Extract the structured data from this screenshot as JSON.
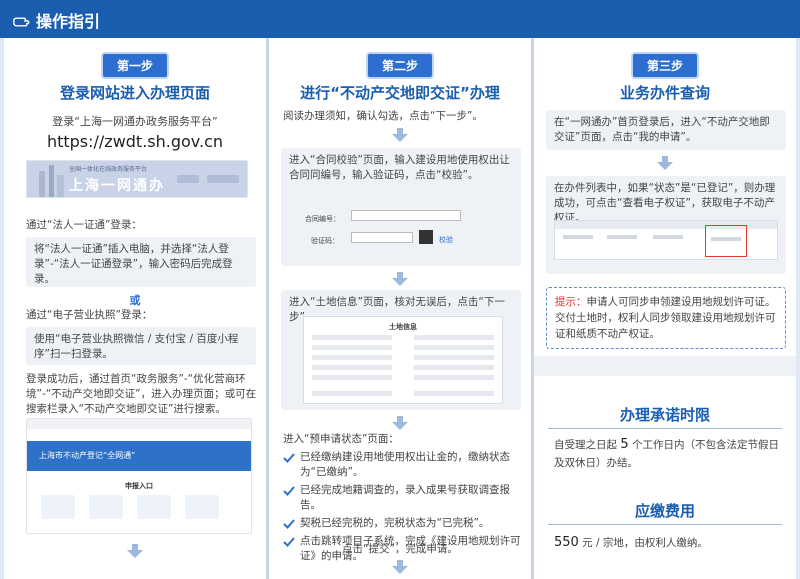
{
  "header": {
    "title": "操作指引"
  },
  "step1": {
    "badge": "第一步",
    "title": "登录网站进入办理页面",
    "login_text": "登录“上海一网通办政务服务平台”",
    "url": "https://zwdt.sh.gov.cn",
    "banner_text": "上海一网通办",
    "banner_sub": "全国一体化在线政务服务平台",
    "legal_label": "通过“法人一证通”登录：",
    "legal_box": "将“法人一证通”插入电脑，并选择“法人登录”-“法人一证通登录”，输入密码后完成登录。",
    "or": "或",
    "license_label": "通过“电子营业执照”登录：",
    "license_box": "使用“电子营业执照微信 / 支付宝 / 百度小程序”扫一扫登录。",
    "after_login": "登录成功后，通过首页“政务服务”-“优化营商环境”-“不动产交地即交证”，进入办理页面；或可在搜索栏录入“不动产交地即交证”进行搜索。",
    "shot_banner": "上海市不动产登记“全网通”",
    "shot_entry": "申报入口"
  },
  "step2": {
    "badge": "第二步",
    "title": "进行“不动产交地即交证”办理",
    "read_text": "阅读办理须知，确认勾选，点击“下一步”。",
    "contract_text": "进入“合同校验”页面，输入建设用地使用权出让合同同编号，输入验证码，点击“校验”。",
    "form_contract_label": "合同编号：",
    "form_code_label": "验证码：",
    "form_btn": "校验",
    "land_text": "进入“土地信息”页面，核对无误后，点击“下一步”。",
    "land_form_title": "土地信息",
    "pre_status_text": "进入“预申请状态”页面：",
    "checks": [
      "已经缴纳建设用地使用权出让金的，缴纳状态为“已缴纳”。",
      "已经完成地籍调查的，录入成果号获取调查报告。",
      "契税已经完税的，完税状态为“已完税”。",
      "点击跳转项目子系统，完成《建设用地规划许可证》的申请。"
    ],
    "submit_text": "点击“提交”，完成申请。"
  },
  "step3": {
    "badge": "第三步",
    "title": "业务办件查询",
    "query_box": "在“一网通办”首页登录后，进入“不动产交地即交证”页面，点击“我的申请”。",
    "list_box": "在办件列表中，如果“状态”是“已登记”，则办理成功，可点击“查看电子权证”，获取电子不动产权证。",
    "tip_label": "提示：",
    "tip_text": "申请人可同步申领建设用地规划许可证。交付土地时，权利人同步领取建设用地规划许可证和纸质不动产权证。"
  },
  "promise": {
    "title": "办理承诺时限",
    "text_prefix": "自受理之日起",
    "days": "5",
    "text_suffix": "个工作日内（不包含法定节假日及双休日）办结。"
  },
  "fee": {
    "title": "应缴费用",
    "amount": "550",
    "text": "元 / 宗地，由权利人缴纳。"
  },
  "colors": {
    "header": "#1b5eb0",
    "accent": "#2d6fd0",
    "tip": "#d8342c",
    "highlight": "#e03a2f"
  }
}
